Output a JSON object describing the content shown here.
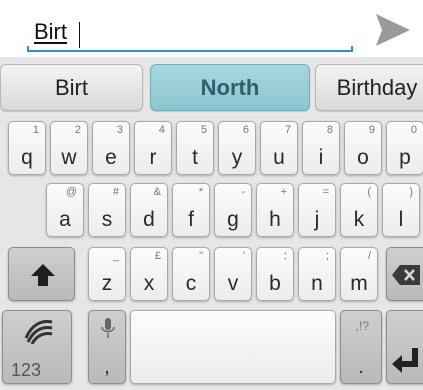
{
  "input": {
    "text": "Birt"
  },
  "suggestions": [
    {
      "label": "Birt",
      "active": false
    },
    {
      "label": "North",
      "active": true
    },
    {
      "label": "Birthday",
      "active": false
    }
  ],
  "keyboard": {
    "row1": [
      {
        "main": "q",
        "hint": "1"
      },
      {
        "main": "w",
        "hint": "2"
      },
      {
        "main": "e",
        "hint": "3"
      },
      {
        "main": "r",
        "hint": "4"
      },
      {
        "main": "t",
        "hint": "5"
      },
      {
        "main": "y",
        "hint": "6"
      },
      {
        "main": "u",
        "hint": "7"
      },
      {
        "main": "i",
        "hint": "8"
      },
      {
        "main": "o",
        "hint": "9"
      },
      {
        "main": "p",
        "hint": "0"
      }
    ],
    "row2": [
      {
        "main": "a",
        "hint": "@"
      },
      {
        "main": "s",
        "hint": "#"
      },
      {
        "main": "d",
        "hint": "&"
      },
      {
        "main": "f",
        "hint": "*"
      },
      {
        "main": "g",
        "hint": "-"
      },
      {
        "main": "h",
        "hint": "+"
      },
      {
        "main": "j",
        "hint": "="
      },
      {
        "main": "k",
        "hint": "("
      },
      {
        "main": "l",
        "hint": ")"
      }
    ],
    "row3": [
      {
        "main": "z",
        "hint": "_"
      },
      {
        "main": "x",
        "hint": "£"
      },
      {
        "main": "c",
        "hint": "\""
      },
      {
        "main": "v",
        "hint": "'"
      },
      {
        "main": "b",
        "hint": ":"
      },
      {
        "main": "n",
        "hint": ";"
      },
      {
        "main": "m",
        "hint": "/"
      }
    ],
    "symbols_label": "123",
    "comma_label": ",",
    "period_label": ".",
    "punct_hint": ",!?"
  },
  "colors": {
    "accent": "#2a93c7",
    "suggestion_active": "#8bc5d0"
  },
  "icons": [
    "send-icon",
    "shift-icon",
    "backspace-icon",
    "swipe-icon",
    "microphone-icon",
    "enter-icon"
  ]
}
